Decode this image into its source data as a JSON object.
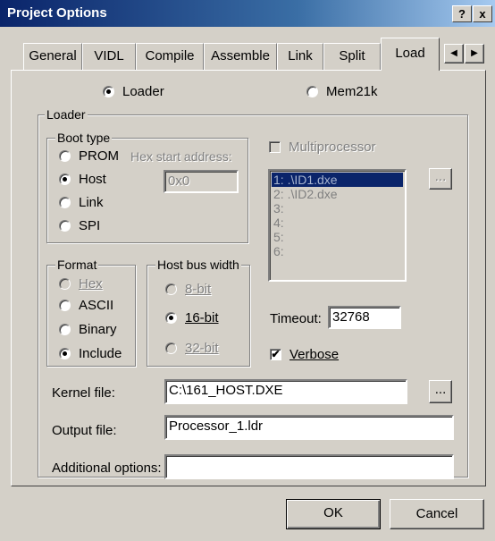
{
  "window": {
    "title": "Project Options",
    "help_btn": "?",
    "close_btn": "x"
  },
  "tabs": [
    "General",
    "VIDL",
    "Compile",
    "Assemble",
    "Link",
    "Split",
    "Load"
  ],
  "tab_scroll": {
    "left": "◀",
    "right": "▶"
  },
  "mode": {
    "loader_label": "Loader",
    "mem21k_label": "Mem21k",
    "selected": "Loader"
  },
  "loader_group": {
    "legend": "Loader"
  },
  "boot_type": {
    "legend": "Boot type",
    "options": [
      "PROM",
      "Host",
      "Link",
      "SPI"
    ],
    "selected": "Host",
    "hex_start_label": "Hex start address:",
    "hex_start_value": "0x0"
  },
  "multiprocessor": {
    "label": "Multiprocessor",
    "checked": false,
    "items": [
      "1: .\\ID1.dxe",
      "2: .\\ID2.dxe",
      "3:",
      "4:",
      "5:",
      "6:"
    ],
    "selected_index": 0,
    "browse_label": "..."
  },
  "format": {
    "legend": "Format",
    "options": [
      "Hex",
      "ASCII",
      "Binary",
      "Include"
    ],
    "selected": "Include"
  },
  "host_bus": {
    "legend": "Host bus width",
    "options": [
      "8-bit",
      "16-bit",
      "32-bit"
    ],
    "selected": "16-bit"
  },
  "timeout": {
    "label": "Timeout:",
    "value": "32768"
  },
  "verbose": {
    "label": "Verbose",
    "checked": true
  },
  "kernel_file": {
    "label": "Kernel file:",
    "value": "C:\\161_HOST.DXE",
    "browse_label": "..."
  },
  "output_file": {
    "label": "Output file:",
    "value": "Processor_1.ldr"
  },
  "additional_options": {
    "label": "Additional options:",
    "value": ""
  },
  "buttons": {
    "ok": "OK",
    "cancel": "Cancel"
  },
  "colors": {
    "titlebar_start": "#0a246a",
    "titlebar_end": "#a6caf0",
    "face": "#d4d0c8",
    "selection": "#0a246a"
  }
}
